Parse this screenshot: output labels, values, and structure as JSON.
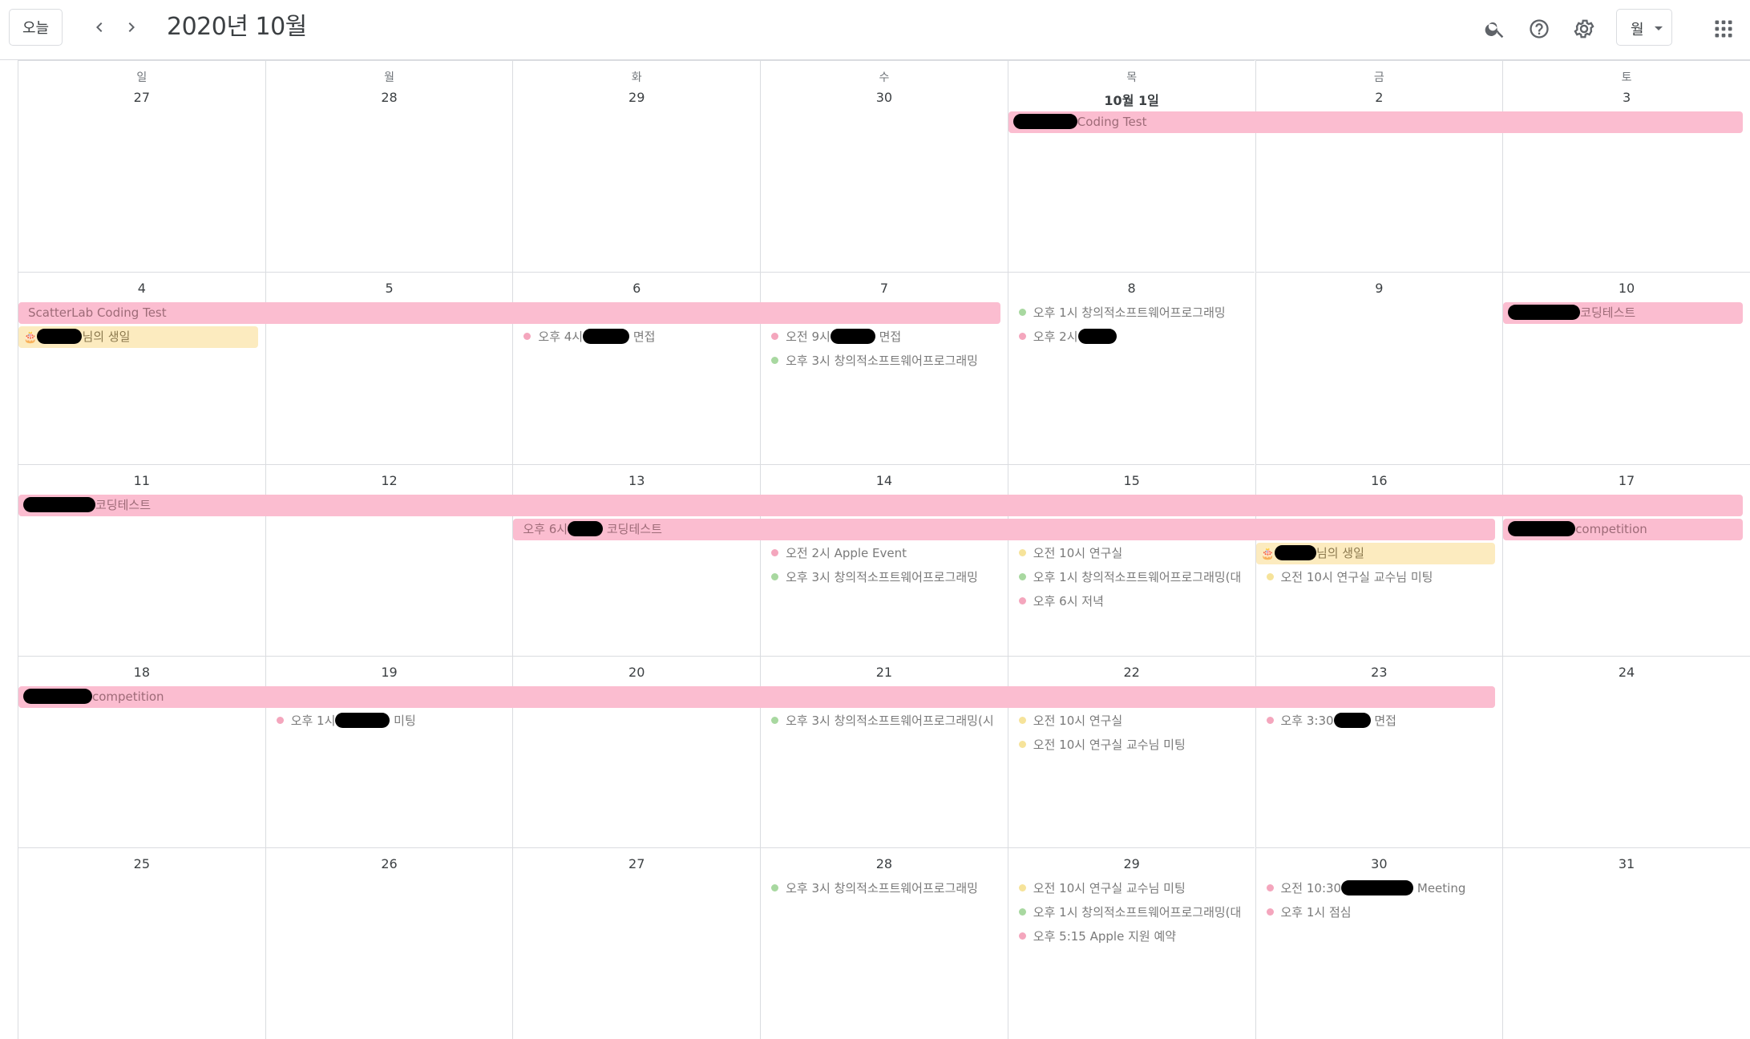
{
  "header": {
    "today_label": "오늘",
    "title": "2020년 10월",
    "view_label": "월",
    "icons": {
      "prev": "chevron-left-icon",
      "next": "chevron-right-icon",
      "search": "search-icon",
      "help": "help-icon",
      "settings": "gear-icon",
      "apps": "apps-grid-icon"
    }
  },
  "colors": {
    "pink_bar": "#fbbdd0",
    "yellow_bar": "#fcebbf",
    "pink_dot": "#f4a6bd",
    "green_dot": "#a8d8a0",
    "yellow_dot": "#f6e39a",
    "border": "#dadce0"
  },
  "weekdays": [
    "일",
    "월",
    "화",
    "수",
    "목",
    "금",
    "토"
  ],
  "weeks": [
    {
      "days": [
        "27",
        "28",
        "29",
        "30",
        "10월 1일",
        "2",
        "3"
      ],
      "bars": [
        {
          "start": 4,
          "span": 3,
          "lane": 0,
          "color": "pink",
          "redacted": 80,
          "text": "Coding Test",
          "cake": false
        }
      ],
      "events": []
    },
    {
      "days": [
        "4",
        "5",
        "6",
        "7",
        "8",
        "9",
        "10"
      ],
      "bars": [
        {
          "start": 0,
          "span": 4,
          "lane": 0,
          "color": "pink",
          "redacted": 0,
          "text": "ScatterLab Coding Test",
          "cake": false
        },
        {
          "start": 0,
          "span": 1,
          "lane": 1,
          "color": "yellow",
          "redacted": 56,
          "text": "님의 생일",
          "cake": true
        },
        {
          "start": 6,
          "span": 1,
          "lane": 0,
          "color": "pink",
          "redacted": 90,
          "text": "코딩테스트",
          "cake": false
        }
      ],
      "events": [
        {
          "day": 2,
          "lane": 1,
          "dot": "pink",
          "text": "오후 4시",
          "redacted": 58,
          "after": "면접"
        },
        {
          "day": 3,
          "lane": 1,
          "dot": "pink",
          "text": "오전 9시",
          "redacted": 56,
          "after": "면접"
        },
        {
          "day": 3,
          "lane": 2,
          "dot": "green",
          "text": "오후 3시 창의적소프트웨어프로그래밍",
          "redacted": 0,
          "after": ""
        },
        {
          "day": 4,
          "lane": 0,
          "dot": "green",
          "text": "오후 1시 창의적소프트웨어프로그래밍",
          "redacted": 0,
          "after": ""
        },
        {
          "day": 4,
          "lane": 1,
          "dot": "pink",
          "text": "오후 2시",
          "redacted": 48,
          "after": ""
        }
      ]
    },
    {
      "days": [
        "11",
        "12",
        "13",
        "14",
        "15",
        "16",
        "17"
      ],
      "bars": [
        {
          "start": 0,
          "span": 7,
          "lane": 0,
          "color": "pink",
          "redacted": 90,
          "text": "코딩테스트",
          "cake": false
        },
        {
          "start": 2,
          "span": 4,
          "lane": 1,
          "color": "pink",
          "redacted": 0,
          "text": "오후 6시",
          "after_blob": 44,
          "text2": "코딩테스트",
          "cake": false
        },
        {
          "start": 6,
          "span": 1,
          "lane": 1,
          "color": "pink",
          "redacted": 84,
          "text": "competition",
          "cake": false
        },
        {
          "start": 5,
          "span": 1,
          "lane": 2,
          "color": "yellow",
          "redacted": 52,
          "text": "님의 생일",
          "cake": true
        }
      ],
      "events": [
        {
          "day": 3,
          "lane": 2,
          "dot": "pink",
          "text": "오전 2시 Apple Event",
          "redacted": 0,
          "after": ""
        },
        {
          "day": 3,
          "lane": 3,
          "dot": "green",
          "text": "오후 3시 창의적소프트웨어프로그래밍",
          "redacted": 0,
          "after": ""
        },
        {
          "day": 4,
          "lane": 2,
          "dot": "yellow",
          "text": "오전 10시 연구실",
          "redacted": 0,
          "after": ""
        },
        {
          "day": 4,
          "lane": 3,
          "dot": "green",
          "text": "오후 1시 창의적소프트웨어프로그래밍(대",
          "redacted": 0,
          "after": ""
        },
        {
          "day": 4,
          "lane": 4,
          "dot": "pink",
          "text": "오후 6시 저녁",
          "redacted": 0,
          "after": ""
        },
        {
          "day": 5,
          "lane": 3,
          "dot": "yellow",
          "text": "오전 10시 연구실 교수님 미팅",
          "redacted": 0,
          "after": ""
        }
      ]
    },
    {
      "days": [
        "18",
        "19",
        "20",
        "21",
        "22",
        "23",
        "24"
      ],
      "bars": [
        {
          "start": 0,
          "span": 6,
          "lane": 0,
          "color": "pink",
          "redacted": 86,
          "text": "competition",
          "cake": false
        }
      ],
      "events": [
        {
          "day": 1,
          "lane": 1,
          "dot": "pink",
          "text": "오후 1시",
          "redacted": 68,
          "after": "미팅"
        },
        {
          "day": 3,
          "lane": 1,
          "dot": "green",
          "text": "오후 3시 창의적소프트웨어프로그래밍(시",
          "redacted": 0,
          "after": ""
        },
        {
          "day": 4,
          "lane": 1,
          "dot": "yellow",
          "text": "오전 10시 연구실",
          "redacted": 0,
          "after": ""
        },
        {
          "day": 4,
          "lane": 2,
          "dot": "yellow",
          "text": "오전 10시 연구실 교수님 미팅",
          "redacted": 0,
          "after": ""
        },
        {
          "day": 5,
          "lane": 1,
          "dot": "pink",
          "text": "오후 3:30",
          "redacted": 46,
          "after": "면접"
        }
      ]
    },
    {
      "days": [
        "25",
        "26",
        "27",
        "28",
        "29",
        "30",
        "31"
      ],
      "bars": [],
      "events": [
        {
          "day": 3,
          "lane": 0,
          "dot": "green",
          "text": "오후 3시 창의적소프트웨어프로그래밍",
          "redacted": 0,
          "after": ""
        },
        {
          "day": 4,
          "lane": 0,
          "dot": "yellow",
          "text": "오전 10시 연구실 교수님 미팅",
          "redacted": 0,
          "after": ""
        },
        {
          "day": 4,
          "lane": 1,
          "dot": "green",
          "text": "오후 1시 창의적소프트웨어프로그래밍(대",
          "redacted": 0,
          "after": ""
        },
        {
          "day": 4,
          "lane": 2,
          "dot": "pink",
          "text": "오후 5:15 Apple 지원 예약",
          "redacted": 0,
          "after": ""
        },
        {
          "day": 5,
          "lane": 0,
          "dot": "pink",
          "text": "오전 10:30",
          "redacted": 90,
          "after": "Meeting"
        },
        {
          "day": 5,
          "lane": 1,
          "dot": "pink",
          "text": "오후 1시 점심",
          "redacted": 0,
          "after": ""
        }
      ]
    }
  ]
}
